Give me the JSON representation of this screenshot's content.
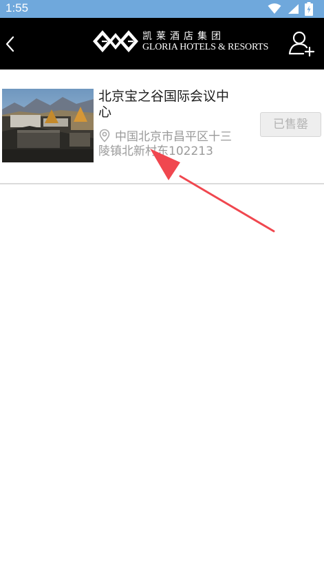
{
  "status_bar": {
    "time": "1:55",
    "icons": [
      "wifi-icon",
      "cell-signal-icon",
      "battery-charging-icon"
    ]
  },
  "header": {
    "back_icon": "chevron-left-icon",
    "logo": {
      "chinese": "凯莱酒店集团",
      "english": "GLORIA HOTELS & RESORTS"
    },
    "user_icon": "user-add-icon"
  },
  "hotel": {
    "name": "北京宝之谷国际会议中心",
    "address": "中国北京市昌平区十三陵镇北新村东102213",
    "status_button": "已售罄"
  },
  "colors": {
    "status_bar": "#6fa8dc",
    "header": "#000000",
    "annotation_arrow": "#f0474f"
  }
}
